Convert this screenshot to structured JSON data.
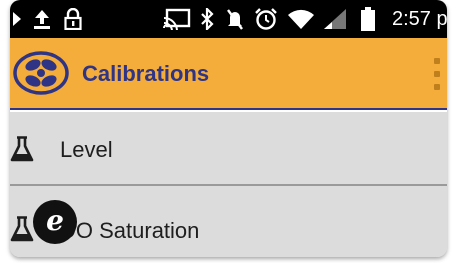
{
  "status_bar": {
    "time": "2:57 p",
    "icons": [
      "video-icon",
      "upload-icon",
      "lock-icon",
      "cast-icon",
      "bluetooth-icon",
      "mute-icon",
      "alarm-icon",
      "wifi-icon",
      "signal-icon",
      "battery-icon"
    ]
  },
  "app_bar": {
    "title": "Calibrations",
    "logo_icon": "propeller-logo",
    "menu_icon": "overflow-menu-icon"
  },
  "list": {
    "items": [
      {
        "label": "Level",
        "icon": "flask-icon"
      },
      {
        "label": "DO Saturation",
        "icon": "flask-icon"
      }
    ]
  },
  "badge": {
    "letter": "e"
  },
  "colors": {
    "app_bar": "#f4ac3a",
    "title": "#2f3584",
    "list_bg": "#dcdcdc",
    "status_bar": "#000000"
  }
}
